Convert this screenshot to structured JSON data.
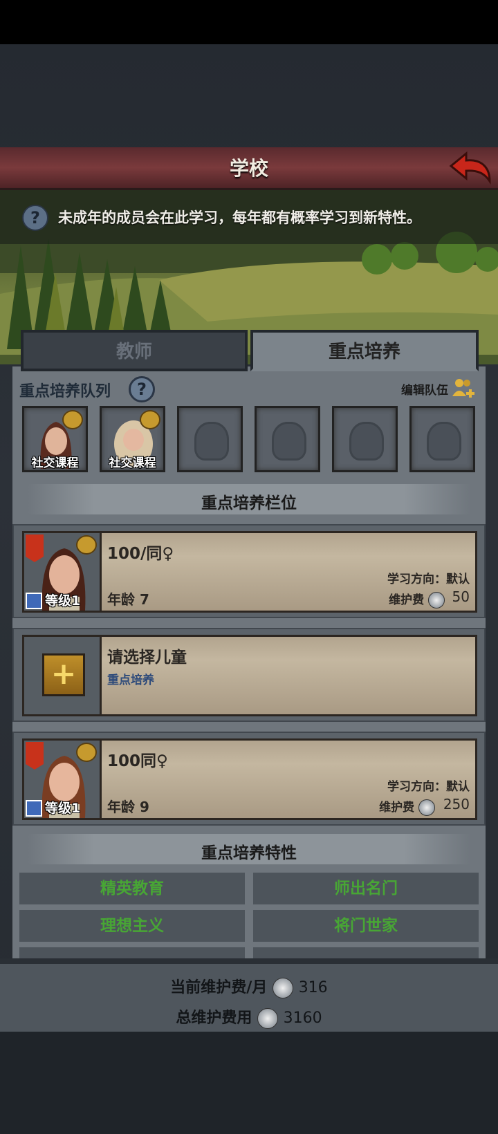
{
  "header": {
    "title": "学校"
  },
  "info": {
    "text": "未成年的成员会在此学习，每年都有概率学习到新特性。",
    "help_icon": "question-icon"
  },
  "tabs": [
    {
      "label": "教师",
      "active": false
    },
    {
      "label": "重点培养",
      "active": true
    }
  ],
  "queue": {
    "title": "重点培养队列",
    "edit_label": "编辑队伍",
    "slots": [
      {
        "label": "社交课程",
        "filled": true
      },
      {
        "label": "社交课程",
        "filled": true
      },
      {
        "filled": false
      },
      {
        "filled": false
      },
      {
        "filled": false
      },
      {
        "filled": false
      }
    ]
  },
  "slots_section": {
    "title": "重点培养栏位"
  },
  "cards": [
    {
      "name": "100/同♀",
      "level": "等级1",
      "age_label": "年龄",
      "age": "7",
      "direction": "学习方向：默认",
      "fee_label": "维护费",
      "fee": "50"
    },
    {
      "empty": true,
      "title": "请选择儿童",
      "subtitle": "重点培养"
    },
    {
      "name": "100同♀",
      "level": "等级1",
      "age_label": "年龄",
      "age": "9",
      "direction": "学习方向：默认",
      "fee_label": "维护费",
      "fee": "250"
    }
  ],
  "traits_section": {
    "title": "重点培养特性",
    "traits": [
      "精英教育",
      "师出名门",
      "理想主义",
      "将门世家"
    ]
  },
  "footer": {
    "monthly_label": "当前维护费/月",
    "monthly_value": "316",
    "total_label": "总维护费用",
    "total_value": "3160"
  },
  "colors": {
    "accent_red": "#7a3a3c",
    "trait_green": "#48a635",
    "gold": "#c69a2e"
  }
}
